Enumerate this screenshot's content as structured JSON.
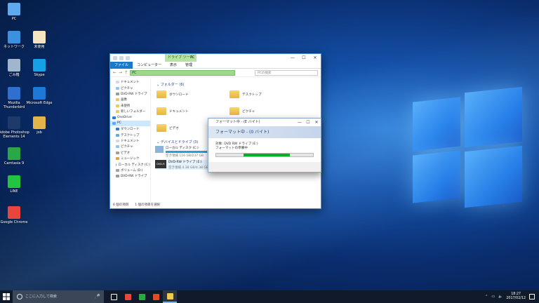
{
  "desktop": {
    "icons": [
      {
        "label": "PC",
        "icon": "pc-icon",
        "color": "#5fa9ef"
      },
      {
        "label": "ネットワーク",
        "icon": "network-icon",
        "color": "#3d8fe0"
      },
      {
        "label": "ごみ箱",
        "icon": "recycle-bin-icon",
        "color": "#9fb6cc"
      },
      {
        "label": "Mozilla Thunderbird",
        "icon": "thunderbird-icon",
        "color": "#2f6fcf"
      },
      {
        "label": "Adobe Photoshop Elements 14",
        "icon": "photoshop-icon",
        "color": "#1e3a6a"
      },
      {
        "label": "Camtasia 9",
        "icon": "camtasia-icon",
        "color": "#2aa845"
      },
      {
        "label": "LINE",
        "icon": "line-icon",
        "color": "#23c441"
      },
      {
        "label": "Google Chrome",
        "icon": "chrome-icon",
        "color": "#e8453c"
      },
      {
        "label": "未使用",
        "icon": "document-icon",
        "color": "#f4e6c0"
      },
      {
        "label": "Skype",
        "icon": "skype-icon",
        "color": "#14a2e4"
      },
      {
        "label": "Microsoft Edge",
        "icon": "edge-icon",
        "color": "#1e78d6"
      },
      {
        "label": "job",
        "icon": "job-file-icon",
        "color": "#e2b44a"
      }
    ]
  },
  "explorer": {
    "title": "PC",
    "context_tab": "ドライブ ツール",
    "ribbon_tabs": [
      "ファイル",
      "コンピューター",
      "表示",
      "管理"
    ],
    "address": "PC",
    "search_placeholder": "PCの検索",
    "nav_items": [
      {
        "label": "ドキュメント",
        "color": "#cfd8e3"
      },
      {
        "label": "ピクチャ",
        "color": "#8fc3f0"
      },
      {
        "label": "DVD-RW ドライブ",
        "color": "#9a9a9a"
      },
      {
        "label": "画像",
        "color": "#f1c75a"
      },
      {
        "label": "未使用",
        "color": "#f1c75a"
      },
      {
        "label": "新しいフォルダー",
        "color": "#f1c75a"
      },
      {
        "label": "OneDrive",
        "color": "#2d7cd6"
      },
      {
        "label": "PC",
        "color": "#5fa9ef"
      },
      {
        "label": "ダウンロード",
        "color": "#2d7cd6"
      },
      {
        "label": "デスクトップ",
        "color": "#5fa9ef"
      },
      {
        "label": "ドキュメント",
        "color": "#cfd8e3"
      },
      {
        "label": "ピクチャ",
        "color": "#8fc3f0"
      },
      {
        "label": "ビデオ",
        "color": "#a0a0a0"
      },
      {
        "label": "ミュージック",
        "color": "#e8a040"
      },
      {
        "label": "ローカル ディスク (C:)",
        "color": "#8ab4d8"
      },
      {
        "label": "ボリューム (D:)",
        "color": "#9aa4ad"
      },
      {
        "label": "DVD-RW ドライブ",
        "color": "#9a9a9a"
      }
    ],
    "folders_header": "フォルダー (6)",
    "folders": [
      "ダウンロード",
      "デスクトップ",
      "ドキュメント",
      "ピクチャ",
      "ビデオ"
    ],
    "devices_header": "デバイスとドライブ (3)",
    "drive_c": {
      "name": "ローカル ディスク (C:)",
      "free": "空き領域 116 GB/237 GB",
      "used_fraction": 0.51
    },
    "drive_dvd": {
      "name": "DVD-RW ドライブ (E:)",
      "free": "空き領域 4.38 GB/4.38 GB",
      "badge": "DVD-R"
    },
    "status": "6 個の項目　　1 個の項目を選択"
  },
  "dialog": {
    "title": "フォーマット中 - (E バイト)",
    "heading": "フォーマット中 - (0 バイト)",
    "target": "対象: DVD RW ドライブ (E:)",
    "status": "フォーマットの準備中",
    "progress": 0.48,
    "progress_color": "#06b025"
  },
  "taskbar": {
    "search_placeholder": "ここに入力して検索",
    "apps": [
      {
        "icon": "task-view-icon",
        "color": "#ffffff"
      },
      {
        "icon": "chrome-icon",
        "color": "#e8453c"
      },
      {
        "icon": "camtasia-icon",
        "color": "#2aa845"
      },
      {
        "icon": "recorder-icon",
        "color": "#e04b2c"
      },
      {
        "icon": "file-explorer-icon",
        "color": "#f1c75a"
      }
    ],
    "time": "18:27",
    "date": "2017/02/12"
  }
}
